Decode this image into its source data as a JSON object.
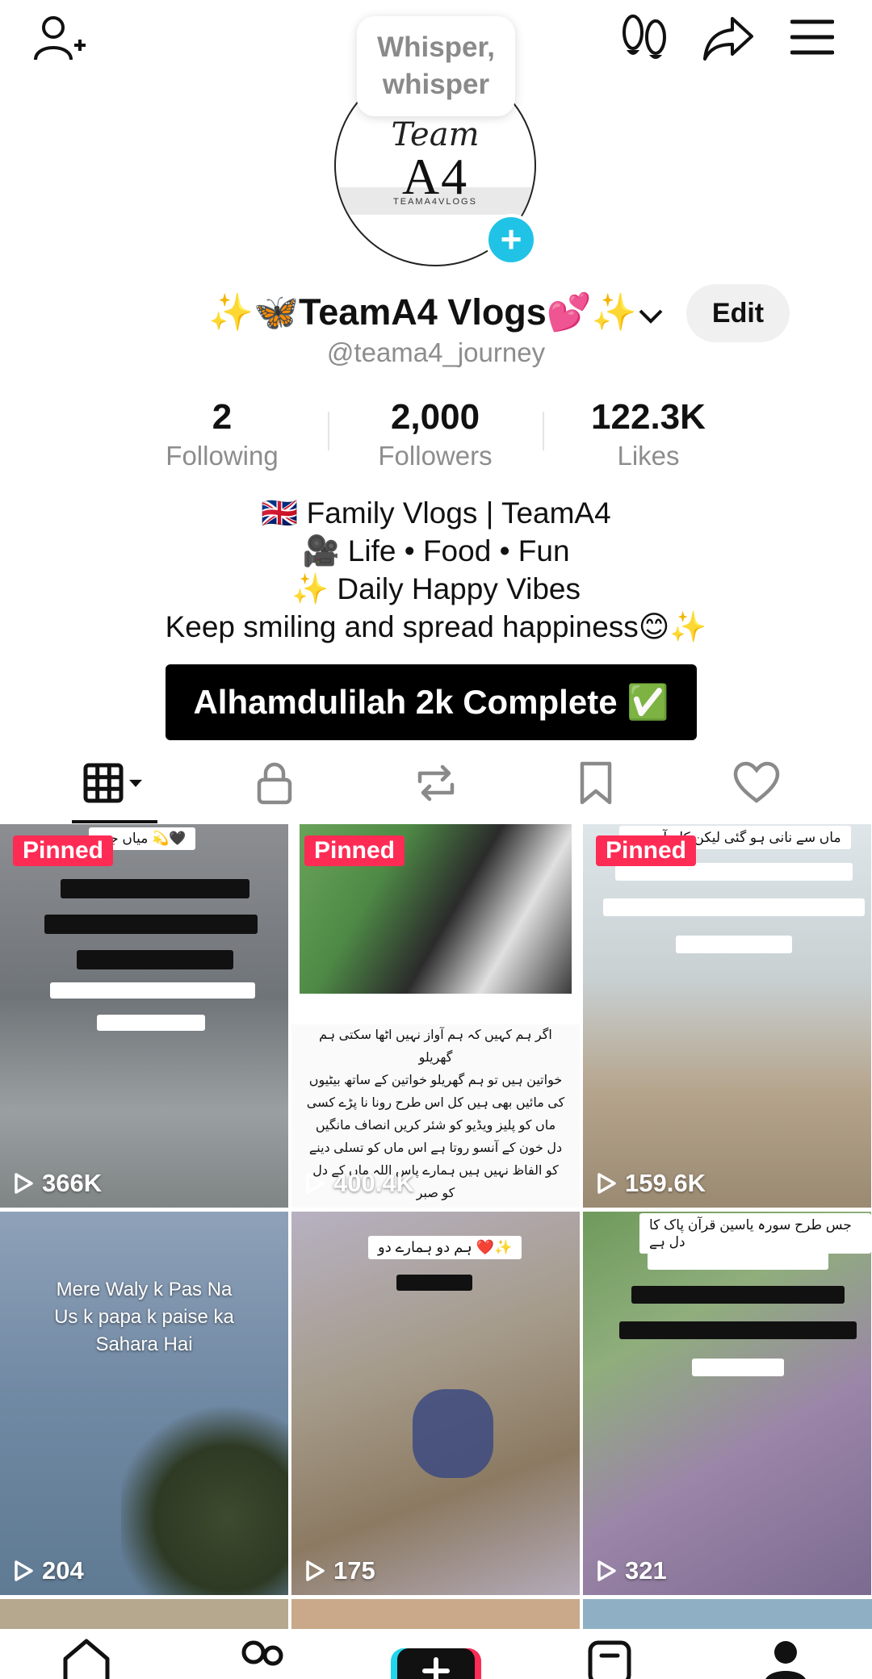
{
  "tooltip": {
    "text": "Whisper,\nwhisper"
  },
  "profile": {
    "avatar_logo": {
      "script": "Team",
      "mark": "A4",
      "sub": "TEAMA4VLOGS"
    },
    "display_name": "✨🦋TeamA4 Vlogs💕✨",
    "handle": "@teama4_journey",
    "edit_label": "Edit"
  },
  "stats": [
    {
      "value": "2",
      "label": "Following"
    },
    {
      "value": "2,000",
      "label": "Followers"
    },
    {
      "value": "122.3K",
      "label": "Likes"
    }
  ],
  "bio": [
    "🇬🇧 Family Vlogs | TeamA4",
    "🎥 Life • Food • Fun",
    "✨ Daily Happy Vibes",
    "Keep smiling and spread happiness😊✨"
  ],
  "banner": {
    "text": "Alhamdulilah 2k Complete ✅"
  },
  "icons": {
    "top_bar": [
      "add-friend-icon",
      "footprints-icon",
      "share-icon",
      "menu-icon"
    ],
    "tabs": [
      "grid-icon",
      "lock-icon",
      "repost-icon",
      "bookmark-icon",
      "heart-icon"
    ],
    "bottom_nav": [
      "home-icon",
      "friends-icon",
      "create-icon",
      "inbox-icon",
      "profile-icon"
    ]
  },
  "videos": [
    {
      "pinned": "Pinned",
      "views": "366K",
      "caption": "میاں جی 💫🖤"
    },
    {
      "pinned": "Pinned",
      "views": "400.4K",
      "caption": "اگر ہم کہیں کہ ہم آواز نہیں اٹھا سکتی ہم گھریلو\nخواتین ہیں تو ہم گھریلو خواتین کے ساتھ بیٹیوں\nکی مائیں بھی ہیں کل اس طرح رونا نا پڑے کسی\nماں کو پلیز ویڈیو کو شئر کریں انصاف مانگیں\nدل خون کے آنسو روتا ہے اس ماں کو تسلی دینے\nکو الفاظ نہیں ہیں ہمارے پاس اللہ ماں کے دل کو صبر\nدے"
    },
    {
      "pinned": "Pinned",
      "views": "159.6K",
      "caption": "ماں سے نانی ہو گئی لیکن کام آج بھی"
    },
    {
      "pinned": "",
      "views": "204",
      "caption": "Mere Waly k Pas Na\nUs k papa k paise ka\nSahara Hai"
    },
    {
      "pinned": "",
      "views": "175",
      "caption": "ہم دو ہمارے دو ❤️✨"
    },
    {
      "pinned": "",
      "views": "321",
      "caption": "جس طرح سورہ یاسین قرآن پاک کا دل ہے"
    }
  ],
  "colors": {
    "accent": "#fe2c55",
    "avatar_plus": "#20c3e6",
    "muted_text": "#8d8d8d"
  }
}
